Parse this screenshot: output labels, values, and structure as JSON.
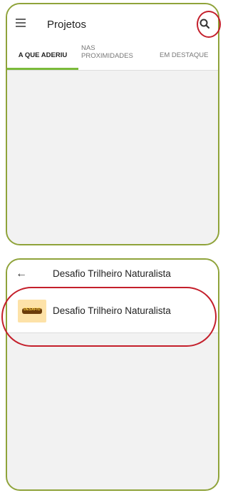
{
  "screen1": {
    "title": "Projetos",
    "icons": {
      "menu": "hamburger-menu-icon",
      "search": "search-icon"
    },
    "tabs": [
      {
        "label": "A QUE ADERIU",
        "active": true
      },
      {
        "label_line1": "NAS",
        "label_line2": "PROXIMIDADES",
        "active": false
      },
      {
        "label": "EM DESTAQUE",
        "active": false
      }
    ]
  },
  "screen2": {
    "title": "Desafio Trilheiro Naturalista",
    "icons": {
      "back": "back-arrow-icon"
    },
    "results": [
      {
        "label": "Desafio Trilheiro Naturalista",
        "thumb_text": "DESAFIO"
      }
    ]
  },
  "colors": {
    "frame_border": "#8fa33a",
    "highlight_circle": "#c41f2b",
    "active_tab_indicator": "#7bbb3a",
    "content_background": "#f2f2f2"
  }
}
